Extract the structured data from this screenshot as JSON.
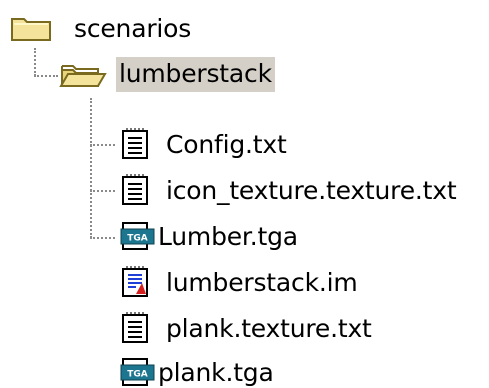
{
  "tree": {
    "root": {
      "label": "scenarios",
      "icon": "folder-closed-icon"
    },
    "child": {
      "label": "lumberstack",
      "icon": "folder-open-icon",
      "selected": true
    },
    "files": [
      {
        "label": "Config.txt",
        "icon": "text-file-icon"
      },
      {
        "label": "icon_texture.texture.txt",
        "icon": "text-file-icon"
      },
      {
        "label": "Lumber.tga",
        "icon": "tga-file-icon"
      },
      {
        "label": "lumberstack.im",
        "icon": "im-file-icon"
      },
      {
        "label": "plank.texture.txt",
        "icon": "text-file-icon"
      },
      {
        "label": "plank.tga",
        "icon": "tga-file-icon"
      }
    ],
    "colors": {
      "folder": "#f4e39a",
      "folder_border": "#7a6a20",
      "selection": "#d4d0c8",
      "tree_lines": "#8a8a8a",
      "tga_blue": "#1d7690",
      "im_red": "#d61f1f"
    }
  }
}
